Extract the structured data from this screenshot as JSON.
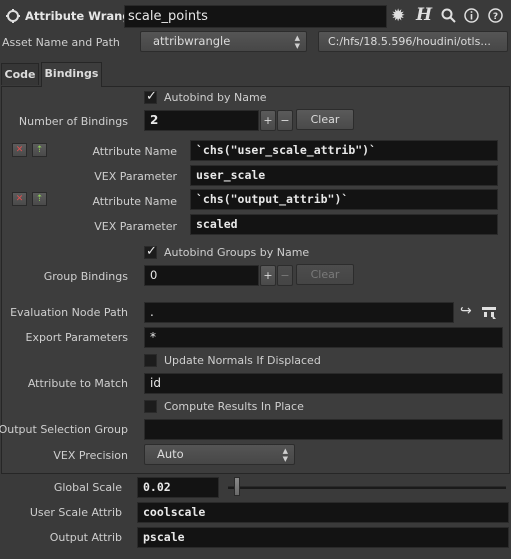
{
  "header": {
    "node_type": "Attribute Wrangle",
    "node_name": "scale_points",
    "help_icon_letter": "H"
  },
  "asset": {
    "label": "Asset Name and Path",
    "name": "attribwrangle",
    "path": "C:/hfs/18.5.596/houdini/otls..."
  },
  "tabs": [
    {
      "label": "Code"
    },
    {
      "label": "Bindings"
    }
  ],
  "bindings": {
    "autobind_label": "Autobind by Name",
    "number_label": "Number of Bindings",
    "number_value": "2",
    "clear_label": "Clear",
    "items": [
      {
        "attr_label": "Attribute Name",
        "attr_value": "`chs(\"user_scale_attrib\")`",
        "vex_label": "VEX Parameter",
        "vex_value": "user_scale"
      },
      {
        "attr_label": "Attribute Name",
        "attr_value": "`chs(\"output_attrib\")`",
        "vex_label": "VEX Parameter",
        "vex_value": "scaled"
      }
    ],
    "autobind_groups_label": "Autobind Groups by Name",
    "group_label": "Group Bindings",
    "group_value": "0",
    "group_clear_label": "Clear",
    "eval_label": "Evaluation Node Path",
    "eval_value": ".",
    "export_label": "Export Parameters",
    "export_value": "*",
    "update_normals_label": "Update Normals If Displaced",
    "attr_match_label": "Attribute to Match",
    "attr_match_value": "id",
    "compute_label": "Compute Results In Place",
    "output_sel_label": "Output Selection Group",
    "output_sel_value": "",
    "precision_label": "VEX Precision",
    "precision_value": "Auto"
  },
  "spare": {
    "global_scale_label": "Global Scale",
    "global_scale_value": "0.02",
    "global_scale_slider_fraction": 0.02,
    "user_scale_label": "User Scale Attrib",
    "user_scale_value": "coolscale",
    "output_label": "Output Attrib",
    "output_value": "pscale"
  },
  "colors": {
    "background": "#3a3a3a",
    "field": "#131313",
    "text": "#cfcfcf"
  }
}
